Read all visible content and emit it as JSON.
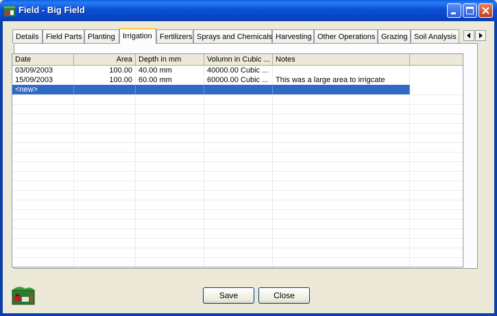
{
  "window": {
    "title": "Field - Big Field",
    "accent": "#0a4fd6"
  },
  "tabs": [
    {
      "label": "Details"
    },
    {
      "label": "Field Parts"
    },
    {
      "label": "Planting"
    },
    {
      "label": "Irrigation"
    },
    {
      "label": "Fertilizers"
    },
    {
      "label": "Sprays and Chemicals"
    },
    {
      "label": "Harvesting"
    },
    {
      "label": "Other Operations"
    },
    {
      "label": "Grazing"
    },
    {
      "label": "Soil Analysis"
    }
  ],
  "selected_tab": "Irrigation",
  "tab_scroll": {
    "left_icon": "triangle-left-icon",
    "right_icon": "triangle-right-icon"
  },
  "grid": {
    "columns": [
      "Date",
      "Area",
      "Depth in mm",
      "Volumn in Cubic ...",
      "Notes"
    ],
    "rows": [
      [
        "03/09/2003",
        "100.00",
        "40.00 mm",
        "40000.00 Cubic ...",
        ""
      ],
      [
        "15/09/2003",
        "100.00",
        "60.00 mm",
        "60000.00 Cubic ...",
        "This was a large area to irrigcate"
      ]
    ],
    "new_row_label": "<new>",
    "selection_color": "#316ac5"
  },
  "buttons": {
    "save": "Save",
    "close": "Close"
  },
  "logo_icon": "farm-logo-icon"
}
